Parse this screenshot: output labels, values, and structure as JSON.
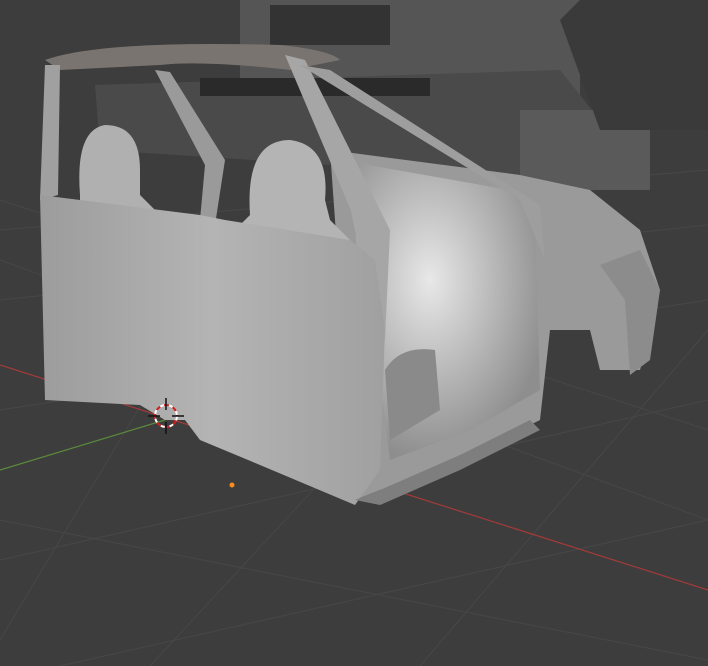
{
  "viewport": {
    "mode": "3d-viewport",
    "background_color": "#3d3d3d",
    "grid_color": "#474747",
    "x_axis_color": "#a33a3a",
    "y_axis_color": "#5c8a3c",
    "origin_color": "#ff8c1a",
    "model_color": "#a8a8a8"
  },
  "icons": {
    "cursor": "3d-cursor-icon",
    "origin": "object-origin-icon"
  }
}
